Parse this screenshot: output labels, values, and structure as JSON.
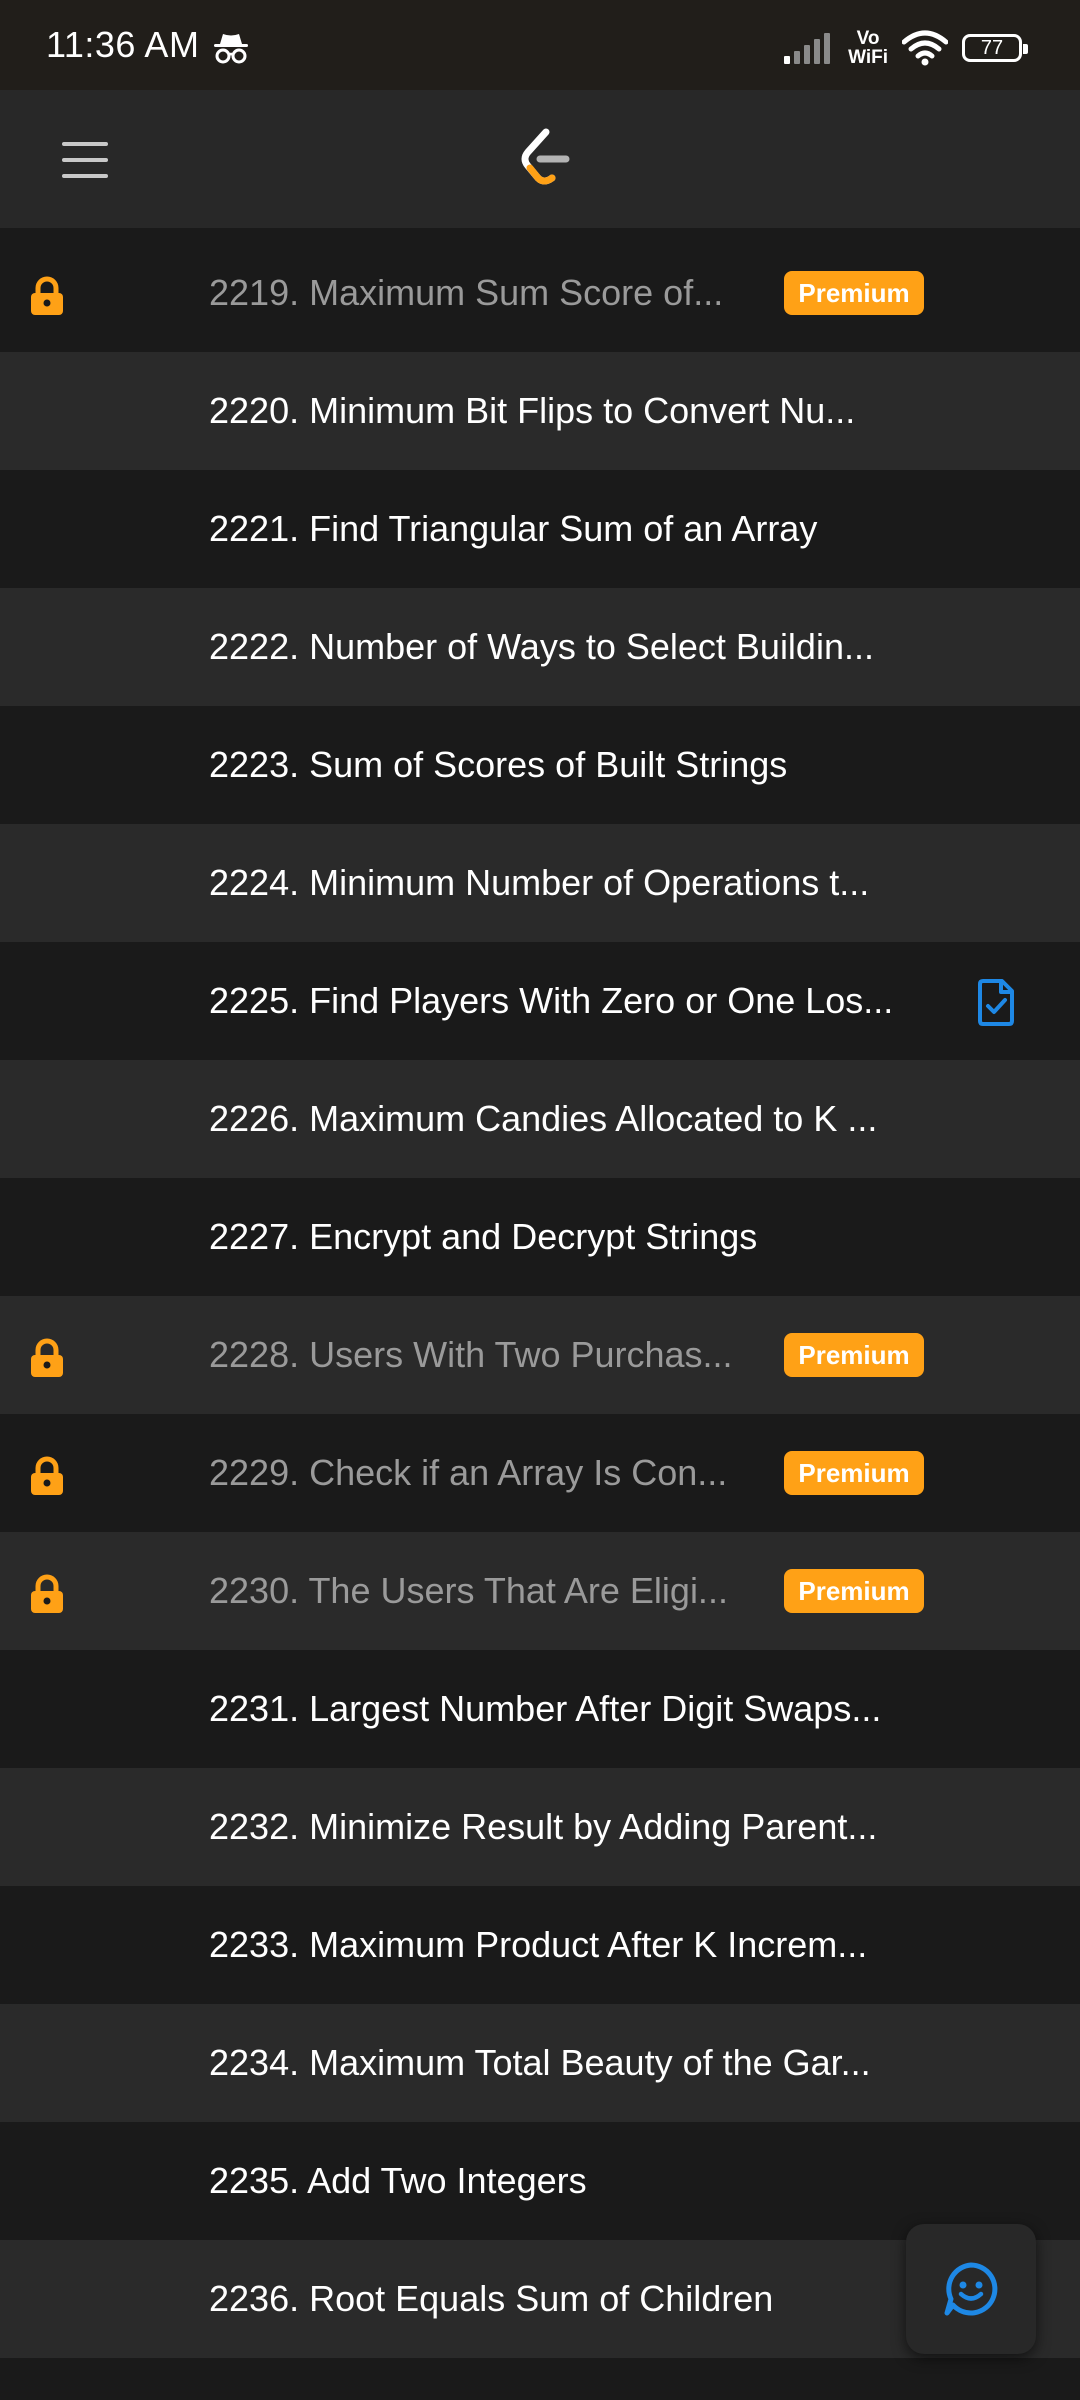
{
  "status_bar": {
    "time": "11:36 AM",
    "network_label_top": "Vo",
    "network_label_bottom": "WiFi",
    "battery": "77"
  },
  "header": {
    "menu_icon": "hamburger-menu-icon",
    "logo": "leetcode-logo"
  },
  "colors": {
    "accent": "#ffa116",
    "solution_blue": "#1e88e5",
    "row_dark": "#1a1a1a",
    "row_light": "#2a2a2a"
  },
  "problems": [
    {
      "title": "2219. Maximum Sum Score of...",
      "locked": true,
      "badge": "Premium",
      "solution": false
    },
    {
      "title": "2220. Minimum Bit Flips to Convert Nu...",
      "locked": false,
      "badge": "",
      "solution": false
    },
    {
      "title": "2221. Find Triangular Sum of an Array",
      "locked": false,
      "badge": "",
      "solution": false
    },
    {
      "title": "2222. Number of Ways to Select Buildin...",
      "locked": false,
      "badge": "",
      "solution": false
    },
    {
      "title": "2223. Sum of Scores of Built Strings",
      "locked": false,
      "badge": "",
      "solution": false
    },
    {
      "title": "2224. Minimum Number of Operations t...",
      "locked": false,
      "badge": "",
      "solution": false
    },
    {
      "title": "2225. Find Players With Zero or One Los...",
      "locked": false,
      "badge": "",
      "solution": true
    },
    {
      "title": "2226. Maximum Candies Allocated to K ...",
      "locked": false,
      "badge": "",
      "solution": false
    },
    {
      "title": "2227. Encrypt and Decrypt Strings",
      "locked": false,
      "badge": "",
      "solution": false
    },
    {
      "title": "2228. Users With Two Purchas...",
      "locked": true,
      "badge": "Premium",
      "solution": false
    },
    {
      "title": "2229. Check if an Array Is Con...",
      "locked": true,
      "badge": "Premium",
      "solution": false
    },
    {
      "title": "2230. The Users That Are Eligi...",
      "locked": true,
      "badge": "Premium",
      "solution": false
    },
    {
      "title": "2231. Largest Number After Digit Swaps...",
      "locked": false,
      "badge": "",
      "solution": false
    },
    {
      "title": "2232. Minimize Result by Adding Parent...",
      "locked": false,
      "badge": "",
      "solution": false
    },
    {
      "title": "2233. Maximum Product After K Increm...",
      "locked": false,
      "badge": "",
      "solution": false
    },
    {
      "title": "2234. Maximum Total Beauty of the Gar...",
      "locked": false,
      "badge": "",
      "solution": false
    },
    {
      "title": "2235. Add Two Integers",
      "locked": false,
      "badge": "",
      "solution": false
    },
    {
      "title": "2236. Root Equals Sum of Children",
      "locked": false,
      "badge": "",
      "solution": false
    }
  ],
  "fab": {
    "icon": "feedback-smiley-icon"
  }
}
